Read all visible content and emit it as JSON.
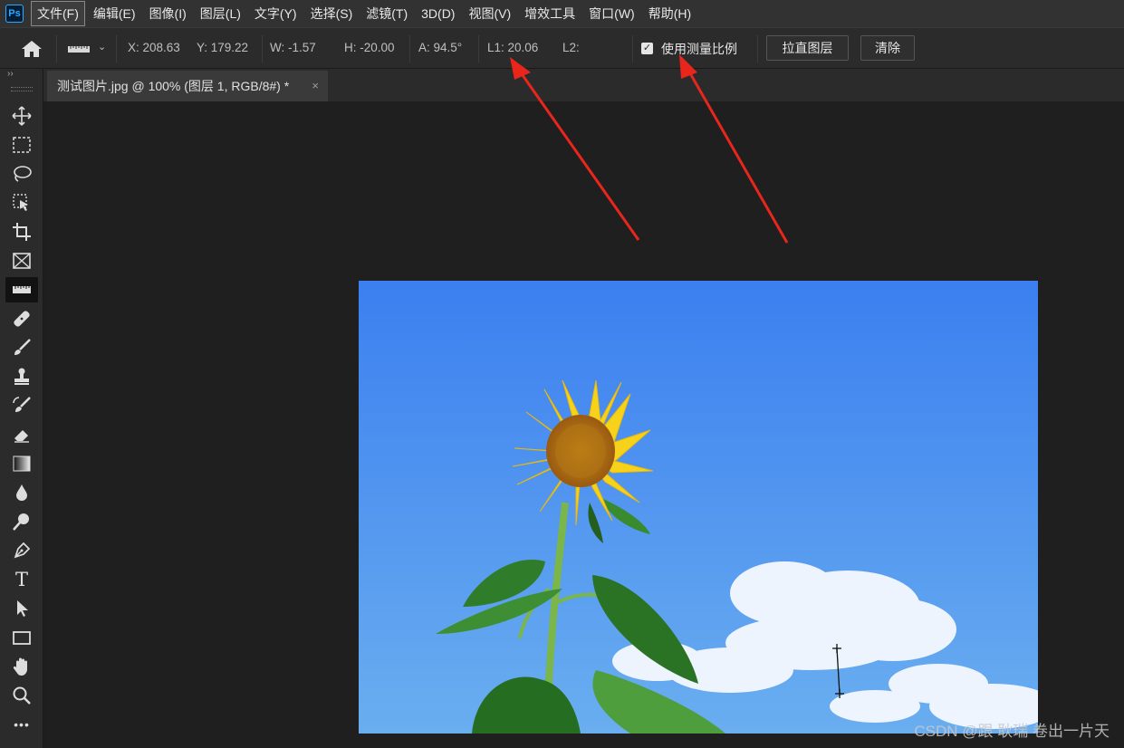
{
  "app": {
    "logo_text": "Ps"
  },
  "menu": {
    "items": [
      "文件(F)",
      "编辑(E)",
      "图像(I)",
      "图层(L)",
      "文字(Y)",
      "选择(S)",
      "滤镜(T)",
      "3D(D)",
      "视图(V)",
      "增效工具",
      "窗口(W)",
      "帮助(H)"
    ],
    "active_index": 0
  },
  "options": {
    "x": "X:  208.63",
    "y": "Y:  179.22",
    "w": "W:  -1.57",
    "h": "H:  -20.00",
    "a": "A:  94.5°",
    "l1": "L1:  20.06",
    "l2": "L2:",
    "use_scale_label": "使用测量比例",
    "use_scale_checked": true,
    "straighten_label": "拉直图层",
    "clear_label": "清除",
    "chevron": "⌄"
  },
  "toolbar": {
    "collapse": "››",
    "tools": [
      "move-tool",
      "marquee-tool",
      "lasso-tool",
      "object-select-tool",
      "crop-tool",
      "frame-tool",
      "ruler-tool",
      "healing-brush-tool",
      "brush-tool",
      "clone-stamp-tool",
      "history-brush-tool",
      "eraser-tool",
      "gradient-tool",
      "blur-tool",
      "dodge-tool",
      "pen-tool",
      "type-tool",
      "path-select-tool",
      "rectangle-tool",
      "hand-tool",
      "zoom-tool",
      "more-tools"
    ],
    "active_tool": "ruler-tool",
    "type_glyph": "T",
    "more_glyph": "•••"
  },
  "document": {
    "tab_title": "测试图片.jpg @ 100% (图层 1, RGB/8#) *",
    "close_glyph": "×"
  },
  "watermark": "CSDN @跟 耿瑞 卷出一片天",
  "colors": {
    "annotation_arrow": "#e8261c",
    "sky_top": "#3b7ff0",
    "sky_bottom": "#6aaef0"
  }
}
